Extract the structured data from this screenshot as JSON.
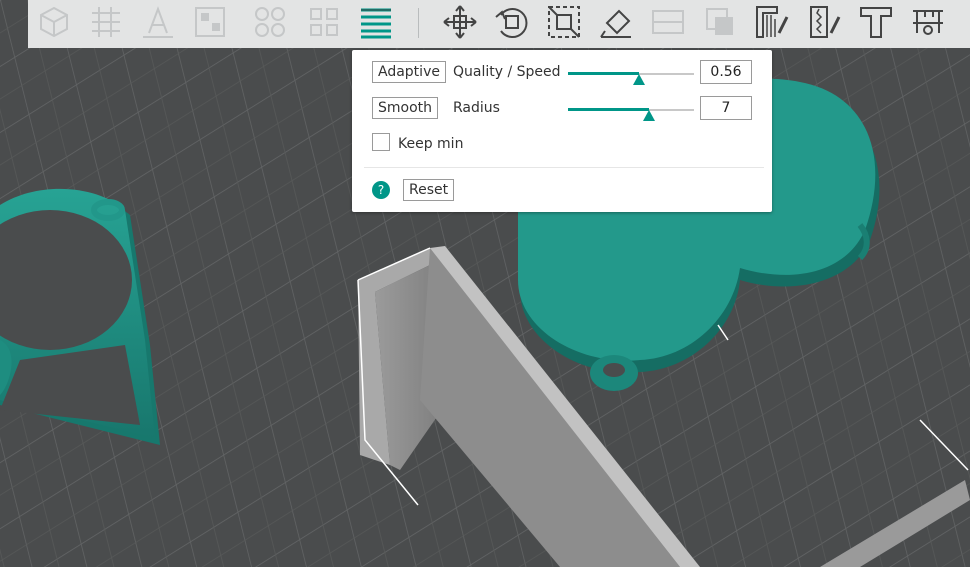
{
  "colors": {
    "accent": "#009688",
    "bed": "#4a4c4d",
    "model_teal": "#1f8f83",
    "model_gray": "#8c8c8c",
    "toolbar_bg": "#e3e4e4"
  },
  "toolbar": {
    "icons": [
      "add-cube-icon",
      "arrange-icon",
      "text-a-icon",
      "layout-icon",
      "split-objects-icon",
      "split-parts-icon",
      "layers-variable-icon",
      "move-icon",
      "rotate-icon",
      "scale-icon",
      "lay-on-face-icon",
      "cut-icon",
      "mesh-boolean-icon",
      "support-paint-icon",
      "seam-paint-icon",
      "text-tool-icon",
      "measure-icon"
    ]
  },
  "panel": {
    "adaptive_button": "Adaptive",
    "quality_label": "Quality / Speed",
    "quality_value": "0.56",
    "quality_fraction": 0.56,
    "smooth_button": "Smooth",
    "radius_label": "Radius",
    "radius_value": "7",
    "radius_fraction": 0.64,
    "keep_min_label": "Keep min",
    "keep_min_checked": false,
    "help_glyph": "?",
    "reset_button": "Reset"
  }
}
